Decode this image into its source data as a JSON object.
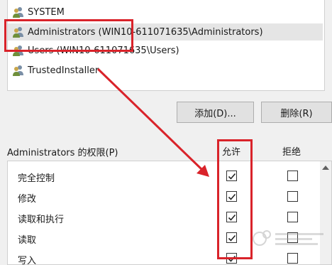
{
  "users": {
    "items": [
      {
        "label": "SYSTEM"
      },
      {
        "label": "Administrators (WIN10-611071635\\Administrators)",
        "selected": true
      },
      {
        "label": "Users (WIN10-611071635\\Users)"
      },
      {
        "label": "TrustedInstaller"
      }
    ]
  },
  "buttons": {
    "add_label": "添加(D)...",
    "remove_label": "删除(R)"
  },
  "permissions": {
    "header_label": "Administrators 的权限(P)",
    "allow_label": "允许",
    "deny_label": "拒绝",
    "rows": [
      {
        "name": "完全控制",
        "allow": true,
        "deny": false
      },
      {
        "name": "修改",
        "allow": true,
        "deny": false
      },
      {
        "name": "读取和执行",
        "allow": true,
        "deny": false
      },
      {
        "name": "读取",
        "allow": true,
        "deny": false
      },
      {
        "name": "写入",
        "allow": true,
        "deny": false
      }
    ]
  },
  "annotation": {
    "color": "#d9232a"
  }
}
